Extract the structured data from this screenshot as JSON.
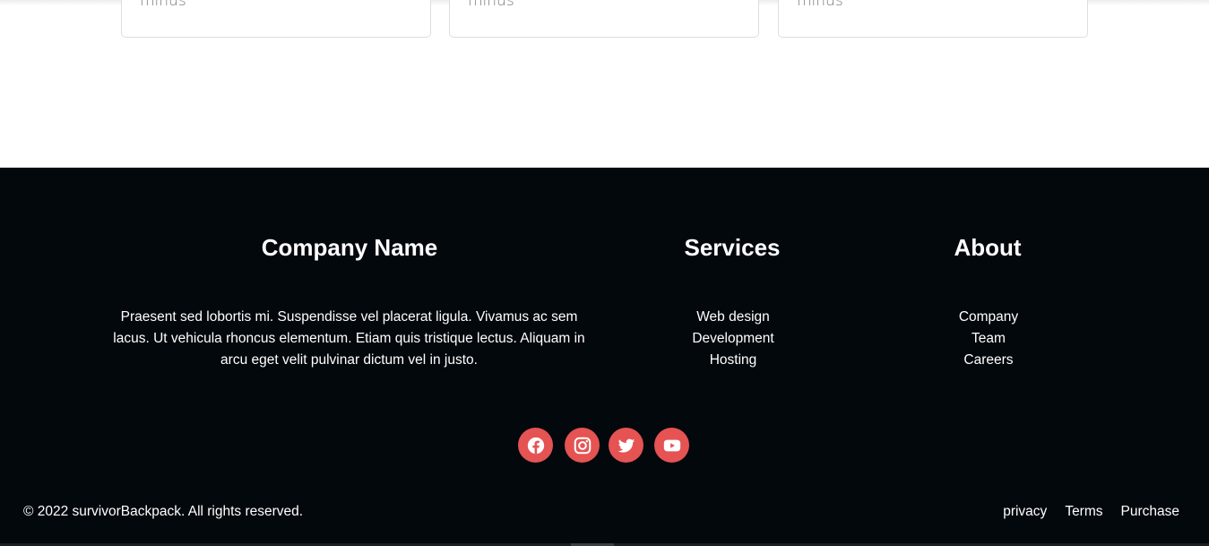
{
  "cards": [
    {
      "text": "minus"
    },
    {
      "text": "minus"
    },
    {
      "text": "minus"
    }
  ],
  "footer": {
    "company": {
      "title": "Company Name",
      "description": "Praesent sed lobortis mi. Suspendisse vel placerat ligula. Vivamus ac sem lacus. Ut vehicula rhoncus elementum. Etiam quis tristique lectus. Aliquam in arcu eget velit pulvinar dictum vel in justo."
    },
    "services": {
      "title": "Services",
      "items": [
        "Web design",
        "Development",
        "Hosting"
      ]
    },
    "about": {
      "title": "About",
      "items": [
        "Company",
        "Team",
        "Careers"
      ]
    },
    "social": [
      {
        "icon": "facebook-icon"
      },
      {
        "icon": "instagram-icon"
      },
      {
        "icon": "twitter-icon"
      },
      {
        "icon": "youtube-icon"
      }
    ],
    "copyright": "© 2022 survivorBackpack. All rights reserved.",
    "bottom_links": [
      "privacy",
      "Terms",
      "Purchase"
    ],
    "colors": {
      "background": "#03080d",
      "accent": "#e55353",
      "text": "#ffffff"
    }
  }
}
